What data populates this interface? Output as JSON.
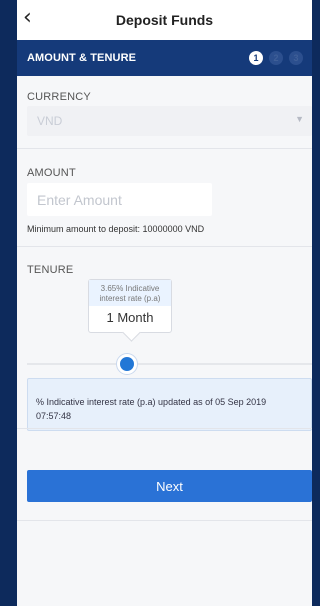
{
  "header": {
    "back_glyph": "‹",
    "title": "Deposit Funds"
  },
  "stepper": {
    "title": "AMOUNT & TENURE",
    "steps": [
      "1",
      "2",
      "3"
    ],
    "active_step": 1
  },
  "currency": {
    "label": "CURRENCY",
    "value": "VND"
  },
  "amount": {
    "label": "AMOUNT",
    "placeholder": "Enter Amount",
    "value": "",
    "min_note": "Minimum amount to deposit: 10000000 VND"
  },
  "tenure": {
    "label": "TENURE",
    "rate_line1": "3.65% Indicative",
    "rate_line2": "interest rate (p.a)",
    "term": "1 Month",
    "slider_level": 0.35,
    "info_line1": "% Indicative interest rate (p.a) updated as of 05 Sep 2019",
    "info_line2": "07:57:48"
  },
  "actions": {
    "next_label": "Next"
  },
  "colors": {
    "background": "#0d2a5c",
    "step_bar": "#153a7a",
    "primary": "#2a72d6"
  }
}
